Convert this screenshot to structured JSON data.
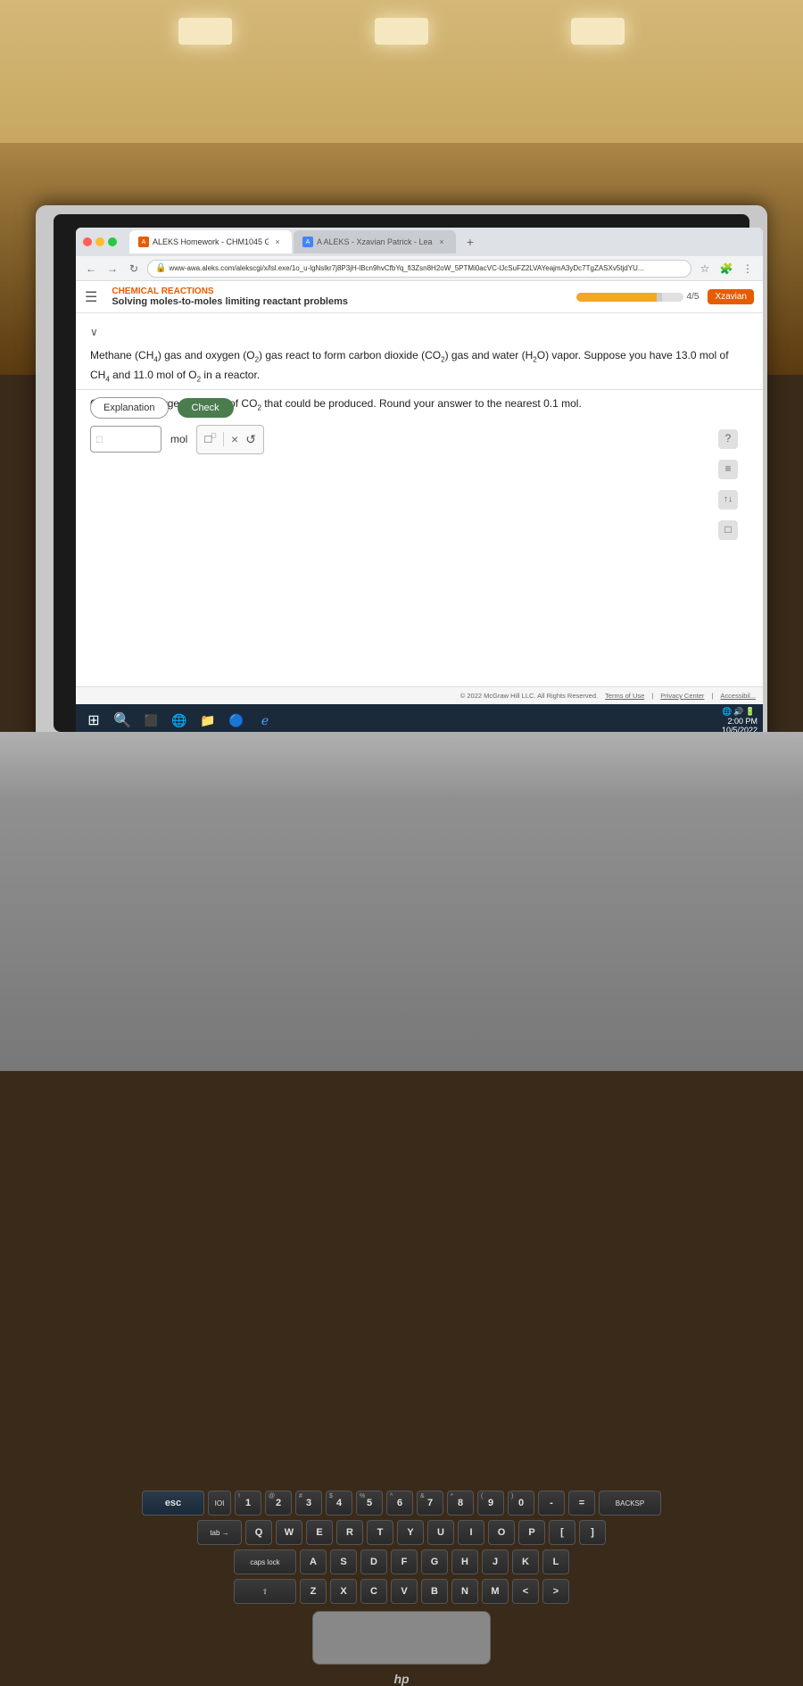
{
  "room": {
    "lights": [
      "light1",
      "light2",
      "light3"
    ]
  },
  "browser": {
    "tabs": [
      {
        "id": "tab1",
        "label": "ALEKS Homework - CHM1045 G...",
        "favicon_type": "aleks",
        "active": true
      },
      {
        "id": "tab2",
        "label": "A ALEKS - Xzavian Patrick - Learn",
        "favicon_type": "a",
        "active": false
      }
    ],
    "url": "www-awa.aleks.com/alekscgi/x/lsl.exe/1o_u-lgNslkr7j8P3jH-lBcn9hvCfbYq_fi3Zsn8H2oW_5PTMi0acVC-lJcSuFZ2LVAYeajmA3yDc7TgZASXv5tjdYU...",
    "tab_add_label": "+"
  },
  "aleks": {
    "section": "CHEMICAL REACTIONS",
    "problem_title": "Solving moles-to-moles limiting reactant problems",
    "progress": "4/5",
    "user": "Xzavian",
    "chevron": "∨",
    "problem_text_line1": "Methane (CH₄) gas and oxygen (O₂) gas react to form carbon dioxide (CO₂) gas and water (H₂O) vapor. Suppose you have 13.0 mol of CH₄ and 11.0 mol",
    "problem_text_line2": "of O₂ in a reactor.",
    "problem_text_line3": "Calculate the largest amount of CO₂ that could be produced. Round your answer to the nearest 0.1 mol.",
    "answer_placeholder": "□",
    "answer_unit": "mol",
    "toolbar_superscript": "□ˣ",
    "toolbar_x": "×",
    "toolbar_undo": "↺",
    "explanation_btn": "Explanation",
    "check_btn": "Check",
    "copyright": "© 2022 McGraw Hill LLC. All Rights Reserved.",
    "terms": "Terms of Use",
    "privacy": "Privacy Center",
    "accessibility": "Accessibil...",
    "time": "2:00 PM",
    "date": "10/5/2022"
  },
  "right_sidebar": {
    "icons": [
      "?",
      "≡",
      "↑↓",
      "□"
    ]
  },
  "taskbar": {
    "items": [
      "⊞",
      "🔍",
      "⬛",
      "🌐",
      "📁",
      "🔵"
    ],
    "time": "2:00 PM",
    "date": "10/5/2022"
  },
  "keyboard": {
    "row1": [
      "esc",
      "IOI",
      "1\n!",
      "2\n@",
      "3\n#",
      "4\n$",
      "5\n%",
      "6\n^",
      "7\n&",
      "8\n*",
      "9\n(",
      "0\n)",
      "-\n_",
      "=\n+",
      "BACKSP"
    ],
    "row2": [
      "tab",
      "Q",
      "W",
      "E",
      "R",
      "T",
      "Y",
      "U",
      "I",
      "O",
      "P",
      "[",
      "]"
    ],
    "row3": [
      "caps lock",
      "A",
      "S",
      "D",
      "F",
      "G",
      "H",
      "J",
      "K",
      "L"
    ],
    "row4": [
      "",
      "Z",
      "X",
      "C",
      "V",
      "B",
      "N",
      "M",
      "<",
      ">"
    ]
  },
  "hp_logo": "hp"
}
